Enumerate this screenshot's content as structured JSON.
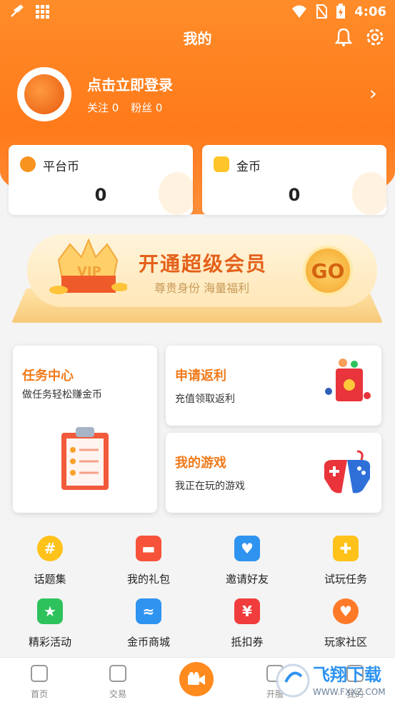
{
  "status": {
    "time": "4:06"
  },
  "header": {
    "title": "我的"
  },
  "profile": {
    "login_text": "点击立即登录",
    "follow_label": "关注 0",
    "fans_label": "粉丝 0"
  },
  "coins": [
    {
      "label": "平台币",
      "value": "0"
    },
    {
      "label": "金币",
      "value": "0"
    }
  ],
  "vip": {
    "badge": "VIP",
    "title": "开通超级会员",
    "subtitle": "尊贵身份 海量福利",
    "go": "GO"
  },
  "cards": [
    {
      "title": "任务中心",
      "subtitle": "做任务轻松赚金币"
    },
    {
      "title": "申请返利",
      "subtitle": "充值领取返利"
    },
    {
      "title": "我的游戏",
      "subtitle": "我正在玩的游戏"
    }
  ],
  "grid": [
    {
      "label": "话题集",
      "icon": "hashtag-icon",
      "color": "#ffc21a"
    },
    {
      "label": "我的礼包",
      "icon": "gift-icon",
      "color": "#f7533a"
    },
    {
      "label": "邀请好友",
      "icon": "mail-heart-icon",
      "color": "#2f93f0"
    },
    {
      "label": "试玩任务",
      "icon": "gamepad-icon",
      "color": "#ffc21a"
    },
    {
      "label": "精彩活动",
      "icon": "star-flag-icon",
      "color": "#2ec25d"
    },
    {
      "label": "金币商城",
      "icon": "store-icon",
      "color": "#2f93f0"
    },
    {
      "label": "抵扣券",
      "icon": "coupon-icon",
      "color": "#f03c3c"
    },
    {
      "label": "玩家社区",
      "icon": "chat-heart-icon",
      "color": "#ff7a28"
    }
  ],
  "tabs": [
    {
      "label": "首页",
      "icon": "home-icon"
    },
    {
      "label": "交易",
      "icon": "yen-icon"
    },
    {
      "label": "",
      "icon": "video-icon"
    },
    {
      "label": "开服",
      "icon": "server-icon"
    },
    {
      "label": "我的",
      "icon": "user-icon"
    }
  ],
  "watermark": {
    "text": "飞翔下载",
    "url": "WWW.FXXZ.COM"
  },
  "colors": {
    "accent": "#ff7a1a",
    "card_title": "#f07a1a"
  }
}
